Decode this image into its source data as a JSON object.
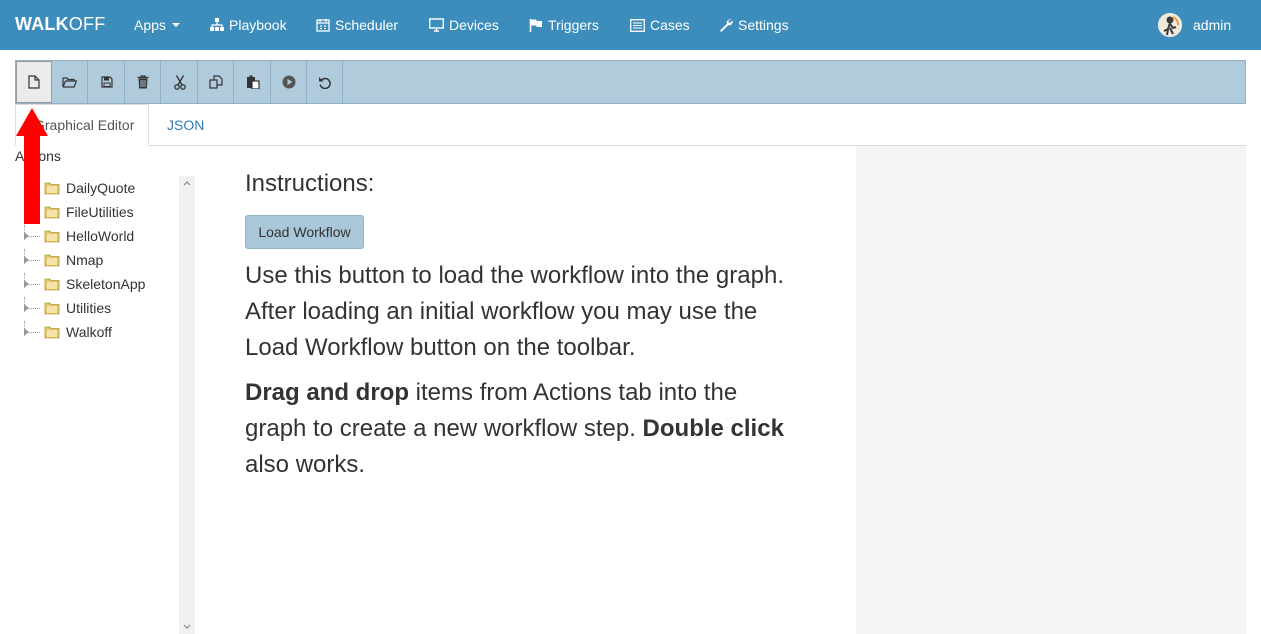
{
  "brand": {
    "part1": "WALK",
    "part2": "OFF"
  },
  "nav": [
    {
      "label": "Apps",
      "icon": "none"
    },
    {
      "label": "Playbook",
      "icon": "sitemap-icon"
    },
    {
      "label": "Scheduler",
      "icon": "calendar-icon"
    },
    {
      "label": "Devices",
      "icon": "monitor-icon"
    },
    {
      "label": "Triggers",
      "icon": "flag-icon"
    },
    {
      "label": "Cases",
      "icon": "list-icon"
    },
    {
      "label": "Settings",
      "icon": "wrench-icon"
    }
  ],
  "user": {
    "name": "admin"
  },
  "toolbar": [
    "new-file-icon",
    "open-folder-icon",
    "save-icon",
    "delete-icon",
    "cut-icon",
    "copy-icon",
    "paste-icon",
    "play-icon",
    "undo-icon"
  ],
  "tabs": {
    "graphical": "Graphical Editor",
    "json": "JSON"
  },
  "actions": {
    "label": "Actions",
    "items": [
      "DailyQuote",
      "FileUtilities",
      "HelloWorld",
      "Nmap",
      "SkeletonApp",
      "Utilities",
      "Walkoff"
    ]
  },
  "instructions": {
    "title": "Instructions:",
    "button": "Load Workflow",
    "para1": "Use this button to load the workflow into the graph. After loading an initial workflow you may use the Load Workflow button on the toolbar.",
    "para2": {
      "b1": "Drag and drop",
      "t1": " items from Actions tab into the graph to create a new workflow step. ",
      "b2": "Double click",
      "t2": " also works."
    }
  },
  "colors": {
    "navbar": "#3c8dbc",
    "toolbar": "#b0cbdc",
    "button": "#a9c7d9",
    "arrow": "#ff0000",
    "link": "#337ab7"
  }
}
